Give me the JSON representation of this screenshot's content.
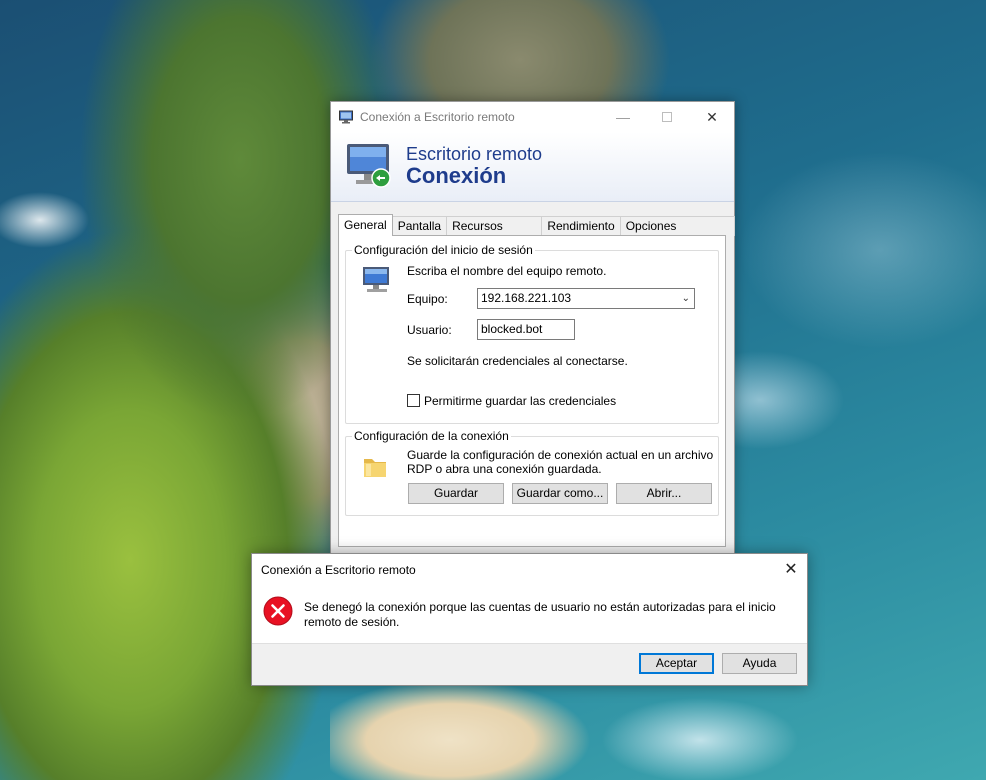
{
  "rdp_window": {
    "title": "Conexión a Escritorio remoto",
    "banner_line1": "Escritorio remoto",
    "banner_line2": "Conexión",
    "tabs": [
      "General",
      "Pantalla",
      "Recursos locales",
      "Rendimiento",
      "Opciones avanzadas"
    ],
    "active_tab": "General",
    "login_group": {
      "legend": "Configuración del inicio de sesión",
      "instruction": "Escriba el nombre del equipo remoto.",
      "computer_label": "Equipo:",
      "computer_value": "192.168.221.103",
      "user_label": "Usuario:",
      "user_value": "blocked.bot",
      "credentials_note": "Se solicitarán credenciales al conectarse.",
      "save_credentials_label": "Permitirme guardar las credenciales",
      "save_credentials_checked": false
    },
    "connection_group": {
      "legend": "Configuración de la conexión",
      "description_line1": "Guarde la configuración de conexión actual en un archivo",
      "description_line2": "RDP o abra una conexión guardada.",
      "save_label": "Guardar",
      "save_as_label": "Guardar como...",
      "open_label": "Abrir..."
    }
  },
  "error_dialog": {
    "title": "Conexión a Escritorio remoto",
    "message_line1": "Se denegó la conexión porque las cuentas de usuario no están autorizadas para el inicio",
    "message_line2": "remoto de sesión.",
    "ok_label": "Aceptar",
    "help_label": "Ayuda"
  },
  "icons": {
    "rdp_app": "remote-desktop-icon",
    "monitor": "monitor-icon",
    "folder": "folder-icon",
    "error": "error-icon",
    "close": "close-icon"
  },
  "colors": {
    "banner_text": "#1e3c8c",
    "error_red": "#e81123",
    "focus_blue": "#0078d7"
  }
}
